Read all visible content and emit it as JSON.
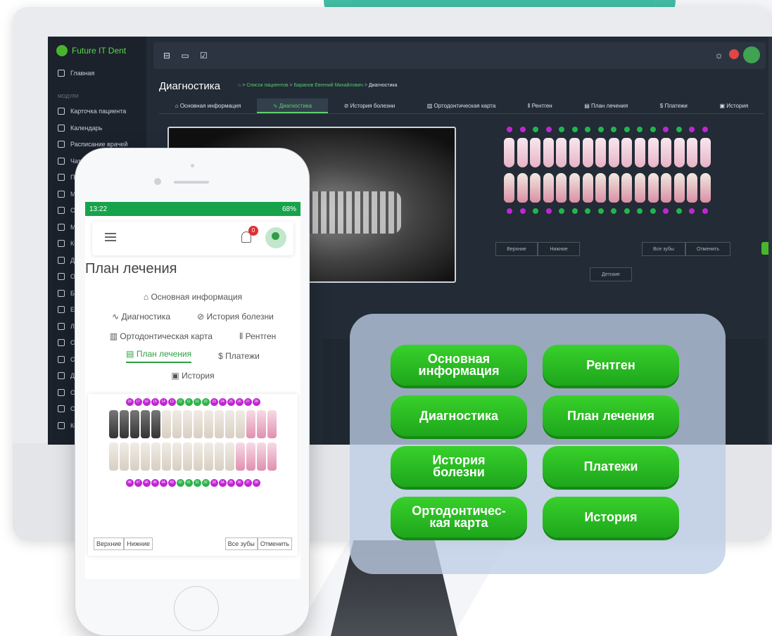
{
  "desktop": {
    "brand": "Future IT Dent",
    "sidebar": {
      "home": "Главная",
      "section_label": "МОДУЛИ",
      "items": [
        "Карточка пациента",
        "Календарь",
        "Расписание врачей",
        "Чат",
        "Почт",
        "Мои",
        "CRM",
        "Мар",
        "Коор",
        "ДМС",
        "Отч",
        "Бюд",
        "EBIT",
        "Лабо",
        "Скла",
        "Скид",
        "Доку",
        "Сотр",
        "Спра",
        "Корз"
      ]
    },
    "topbar": {
      "tool_icons": "⊟ ▭ ☑",
      "sun_icon": "☼"
    },
    "page_title": "Диагностика",
    "breadcrumb": {
      "items": [
        "Список пациентов",
        "Баранов Евгений Михайлович"
      ],
      "current": "Диагностика",
      "separator": ">"
    },
    "tabs": [
      {
        "label": "⌂ Основная информация",
        "active": false
      },
      {
        "label": "∿ Диагностика",
        "active": true
      },
      {
        "label": "⊘ История болезни",
        "active": false
      },
      {
        "label": "▥ Ортодонтическая карта",
        "active": false
      },
      {
        "label": "⦀ Рентген",
        "active": false
      },
      {
        "label": "▤ План лечения",
        "active": false
      },
      {
        "label": "$ Платежи",
        "active": false
      },
      {
        "label": "▣ История",
        "active": false
      }
    ],
    "jaw_buttons": {
      "upper": "Верхние",
      "lower": "Нижние",
      "all": "Все зубы",
      "cancel": "Отменить",
      "child": "Детские"
    }
  },
  "phone": {
    "status_time": "13:22",
    "status_battery": "68%",
    "notification_count": "0",
    "title": "План лечения",
    "nav": {
      "rows": [
        [
          {
            "label": "⌂ Основная информация",
            "active": false
          }
        ],
        [
          {
            "label": "∿ Диагностика",
            "active": false
          },
          {
            "label": "⊘ История болезни",
            "active": false
          }
        ],
        [
          {
            "label": "▥ Ортодонтическая карта",
            "active": false
          },
          {
            "label": "⦀ Рентген",
            "active": false
          }
        ],
        [
          {
            "label": "▤ План лечения",
            "active": true
          },
          {
            "label": "$ Платежи",
            "active": false
          }
        ],
        [
          {
            "label": "▣ История",
            "active": false
          }
        ]
      ]
    },
    "upper_numbers": [
      "18",
      "17",
      "16",
      "15",
      "14",
      "13",
      "12",
      "11",
      "21",
      "22",
      "23",
      "24",
      "25",
      "26",
      "27",
      "28"
    ],
    "lower_numbers": [
      "48",
      "47",
      "46",
      "45",
      "44",
      "43",
      "42",
      "41",
      "31",
      "32",
      "33",
      "34",
      "35",
      "36",
      "37",
      "38"
    ],
    "buttons": {
      "upper": "Верхние",
      "lower": "Нижние",
      "all": "Все зубы",
      "cancel": "Отменить"
    }
  },
  "overlay_buttons": [
    [
      "Основная",
      "информация"
    ],
    [
      "Рентген"
    ],
    [
      "Диагностика"
    ],
    [
      "План лечения"
    ],
    [
      "История",
      "болезни"
    ],
    [
      "Платежи"
    ],
    [
      "Ортодонтичес-",
      "кая карта"
    ],
    [
      "История"
    ]
  ],
  "colors": {
    "accent_green": "#2fb34a",
    "tooth_marker_purple": "#c026d3",
    "dark_bg": "#222b36"
  }
}
